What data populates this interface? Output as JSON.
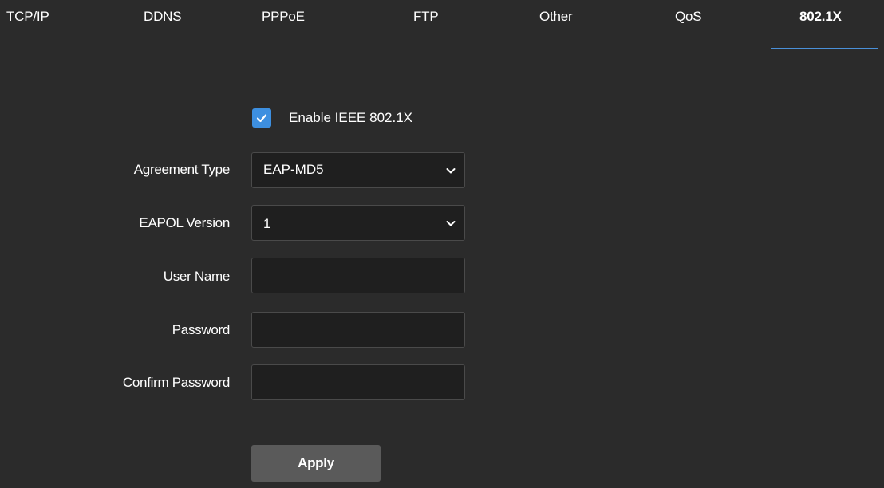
{
  "tabs": [
    {
      "label": "TCP/IP"
    },
    {
      "label": "DDNS"
    },
    {
      "label": "PPPoE"
    },
    {
      "label": "FTP"
    },
    {
      "label": "Other"
    },
    {
      "label": "QoS"
    },
    {
      "label": "802.1X",
      "active": true
    }
  ],
  "form": {
    "enable_label": "Enable IEEE 802.1X",
    "enable_checked": true,
    "agreement_type": {
      "label": "Agreement Type",
      "value": "EAP-MD5"
    },
    "eapol_version": {
      "label": "EAPOL Version",
      "value": "1"
    },
    "user_name": {
      "label": "User Name",
      "value": ""
    },
    "password": {
      "label": "Password",
      "value": ""
    },
    "confirm_password": {
      "label": "Confirm Password",
      "value": ""
    },
    "apply_label": "Apply"
  },
  "colors": {
    "background": "#2b2b2b",
    "accent": "#3d8fe0",
    "field_bg": "#1f1f1f",
    "button_bg": "#5a5a5a"
  },
  "icons": {
    "checkbox": "check-icon",
    "dropdown": "chevron-down-icon"
  }
}
